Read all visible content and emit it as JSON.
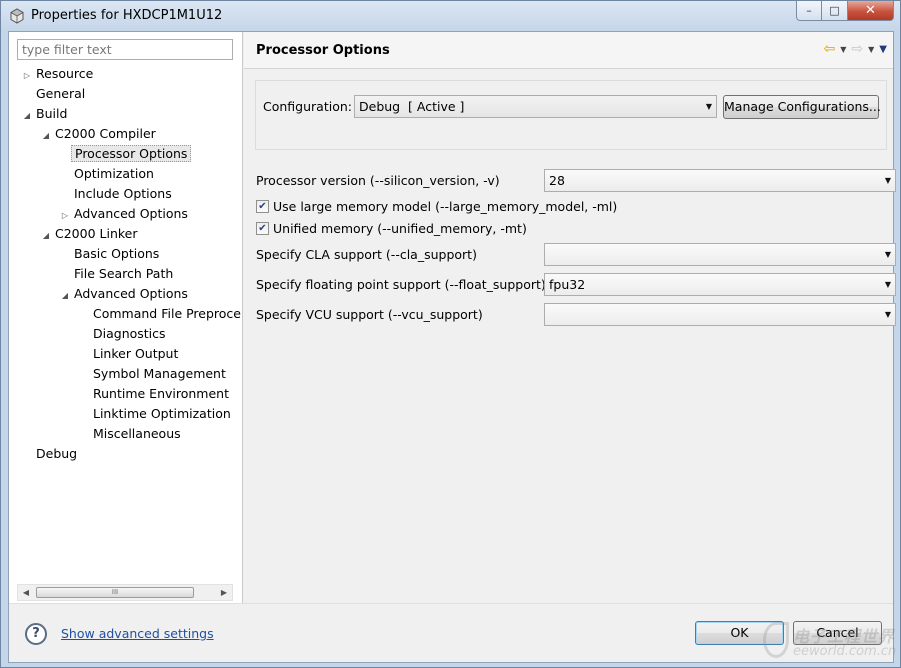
{
  "window": {
    "title": "Properties for HXDCP1M1U12",
    "minimize_glyph": "–",
    "maximize_glyph": "□",
    "close_glyph": "✕"
  },
  "left_pane": {
    "filter_placeholder": "type filter text",
    "tree": [
      {
        "label": "Resource",
        "level": 0,
        "twisty": "collapsed"
      },
      {
        "label": "General",
        "level": 0,
        "twisty": "none"
      },
      {
        "label": "Build",
        "level": 0,
        "twisty": "expanded"
      },
      {
        "label": "C2000 Compiler",
        "level": 1,
        "twisty": "expanded"
      },
      {
        "label": "Processor Options",
        "level": 2,
        "twisty": "none",
        "selected": true
      },
      {
        "label": "Optimization",
        "level": 2,
        "twisty": "none"
      },
      {
        "label": "Include Options",
        "level": 2,
        "twisty": "none"
      },
      {
        "label": "Advanced Options",
        "level": 2,
        "twisty": "collapsed"
      },
      {
        "label": "C2000 Linker",
        "level": 1,
        "twisty": "expanded"
      },
      {
        "label": "Basic Options",
        "level": 2,
        "twisty": "none"
      },
      {
        "label": "File Search Path",
        "level": 2,
        "twisty": "none"
      },
      {
        "label": "Advanced Options",
        "level": 2,
        "twisty": "expanded"
      },
      {
        "label": "Command File Preproce",
        "level": 3,
        "twisty": "none"
      },
      {
        "label": "Diagnostics",
        "level": 3,
        "twisty": "none"
      },
      {
        "label": "Linker Output",
        "level": 3,
        "twisty": "none"
      },
      {
        "label": "Symbol Management",
        "level": 3,
        "twisty": "none"
      },
      {
        "label": "Runtime Environment",
        "level": 3,
        "twisty": "none"
      },
      {
        "label": "Linktime Optimization",
        "level": 3,
        "twisty": "none"
      },
      {
        "label": "Miscellaneous",
        "level": 3,
        "twisty": "none"
      },
      {
        "label": "Debug",
        "level": 0,
        "twisty": "none"
      }
    ],
    "scroll_thumb_grip": "III"
  },
  "right_pane": {
    "title": "Processor Options",
    "configuration": {
      "label": "Configuration:",
      "value": "Debug  [ Active ]",
      "manage_button": "Manage Configurations..."
    },
    "options": {
      "processor_version": {
        "label": "Processor version (--silicon_version, -v)",
        "value": "28"
      },
      "large_memory": {
        "label": "Use large memory model (--large_memory_model, -ml)",
        "checked": true
      },
      "unified_memory": {
        "label": "Unified memory (--unified_memory, -mt)",
        "checked": true
      },
      "cla_support": {
        "label": "Specify CLA support (--cla_support)",
        "value": ""
      },
      "float_support": {
        "label": "Specify floating point support (--float_support)",
        "value": "fpu32"
      },
      "vcu_support": {
        "label": "Specify VCU support (--vcu_support)",
        "value": ""
      }
    }
  },
  "bottom": {
    "help_glyph": "?",
    "advanced_link": "Show advanced settings",
    "ok_label": "OK",
    "cancel_label": "Cancel"
  },
  "watermark": {
    "line1": "电子工程世界",
    "line2": "eeworld.com.cn"
  },
  "colors": {
    "link": "#1e50a2",
    "close_button": "#c7533f",
    "back_arrow": "#d9a300"
  }
}
